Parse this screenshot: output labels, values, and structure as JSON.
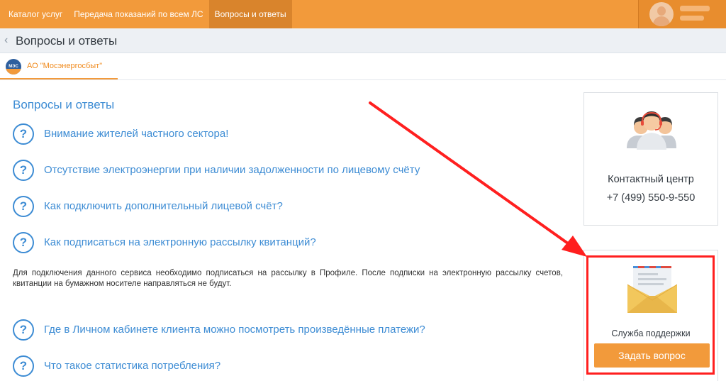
{
  "topnav": {
    "items": [
      {
        "label": "Каталог услуг",
        "active": false
      },
      {
        "label": "Передача показаний по всем ЛС",
        "active": false
      },
      {
        "label": "Вопросы и ответы",
        "active": true
      }
    ]
  },
  "breadcrumb": {
    "title": "Вопросы и ответы"
  },
  "org_tab": {
    "logo_text": "МЭС",
    "name": "АО \"Мосэнергосбыт\""
  },
  "faq": {
    "title": "Вопросы и ответы",
    "items": [
      {
        "question": "Внимание жителей частного сектора!"
      },
      {
        "question": "Отсутствие электроэнергии при наличии задолженности по лицевому счёту"
      },
      {
        "question": "Как подключить дополнительный лицевой счёт?"
      },
      {
        "question": "Как подписаться на электронную рассылку квитанций?"
      },
      {
        "question": "Где в Личном кабинете клиента можно посмотреть произведённые платежи?"
      },
      {
        "question": "Что такое статистика потребления?"
      }
    ],
    "expanded_answer": "Для подключения данного сервиса необходимо подписаться на рассылку в Профиле. После подписки на электронную рассылку счетов, квитанции на бумажном носителе направляться не будут."
  },
  "contact_center": {
    "label": "Контактный центр",
    "phone": "+7 (499) 550-9-550"
  },
  "support": {
    "label": "Служба поддержки",
    "button_label": "Задать вопрос"
  },
  "colors": {
    "brand_orange": "#f29a3b",
    "link_blue": "#3d8cd4",
    "annotation_red": "#ff1f1f"
  }
}
